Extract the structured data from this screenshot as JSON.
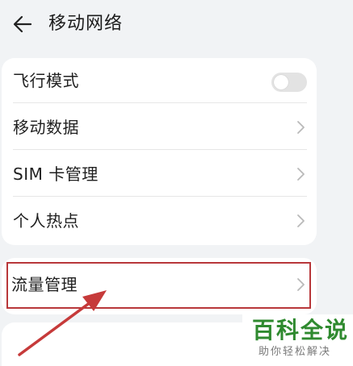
{
  "header": {
    "title": "移动网络",
    "back_icon": "arrow-left-icon"
  },
  "settings": {
    "items": [
      {
        "label": "飞行模式",
        "control": "toggle",
        "toggle_on": false
      },
      {
        "label": "移动数据",
        "control": "chevron"
      },
      {
        "label": "SIM 卡管理",
        "control": "chevron"
      },
      {
        "label": "个人热点",
        "control": "chevron"
      }
    ]
  },
  "traffic": {
    "label": "流量管理",
    "control": "chevron",
    "highlight_color": "#b8373a"
  },
  "watermark": {
    "title": "百科全说",
    "subtitle": "助你轻松解决",
    "title_color": "#2f8a2f"
  }
}
